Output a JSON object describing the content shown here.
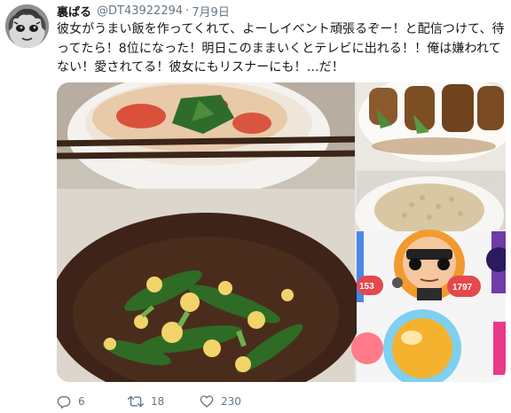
{
  "author": {
    "display_name": "裏ぱる",
    "handle": "@DT43922294",
    "separator": "·",
    "date": "7月9日"
  },
  "tweet": {
    "lines": [
      "彼女がうまい飯を作ってくれて、よーしイベント頑張るぞー！と配信つけて、待",
      "ってたら！8位になった！明日このままいくとテレビに出れる！！俺は嫌われて",
      "ない！愛されてる！彼女にもリスナーにも！…だ！"
    ]
  },
  "media": {
    "badge_left": "153",
    "badge_right": "1797"
  },
  "actions": {
    "replies": "6",
    "retweets": "18",
    "likes": "230"
  },
  "icons": {
    "reply": "reply-icon",
    "retweet": "retweet-icon",
    "like": "heart-icon"
  },
  "colors": {
    "text": "#14171a",
    "secondary": "#657786"
  }
}
